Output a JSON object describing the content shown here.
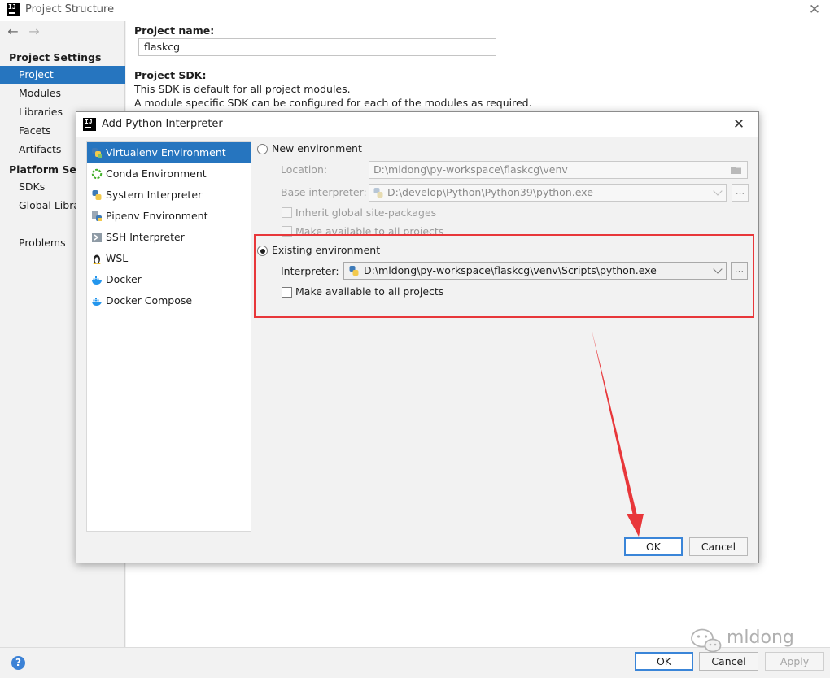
{
  "window": {
    "title": "Project Structure",
    "logo_text": "IJ"
  },
  "sidebar": {
    "project_settings_header": "Project Settings",
    "project_settings_items": [
      {
        "label": "Project",
        "selected": true
      },
      {
        "label": "Modules"
      },
      {
        "label": "Libraries"
      },
      {
        "label": "Facets"
      },
      {
        "label": "Artifacts"
      }
    ],
    "platform_settings_header": "Platform Settings",
    "platform_settings_items": [
      {
        "label": "SDKs"
      },
      {
        "label": "Global Libraries"
      }
    ],
    "problems_label": "Problems"
  },
  "content": {
    "project_name_label": "Project name:",
    "project_name_value": "flaskcg",
    "project_sdk_label": "Project SDK:",
    "sdk_desc_1": "This SDK is default for all project modules.",
    "sdk_desc_2": "A module specific SDK can be configured for each of the modules as required."
  },
  "footer": {
    "help_glyph": "?",
    "ok_label": "OK",
    "cancel_label": "Cancel",
    "apply_label": "Apply"
  },
  "dialog": {
    "title": "Add Python Interpreter",
    "logo_text": "IJ",
    "env_items": [
      {
        "label": "Virtualenv Environment",
        "icon": "virtualenv-icon",
        "selected": true
      },
      {
        "label": "Conda Environment",
        "icon": "conda-icon"
      },
      {
        "label": "System Interpreter",
        "icon": "python-icon"
      },
      {
        "label": "Pipenv Environment",
        "icon": "pipenv-icon"
      },
      {
        "label": "SSH Interpreter",
        "icon": "ssh-icon"
      },
      {
        "label": "WSL",
        "icon": "linux-icon"
      },
      {
        "label": "Docker",
        "icon": "docker-icon"
      },
      {
        "label": "Docker Compose",
        "icon": "docker-compose-icon"
      }
    ],
    "new_env": {
      "label": "New environment",
      "selected": false,
      "location_label": "Location:",
      "location_value": "D:\\mldong\\py-workspace\\flaskcg\\venv",
      "base_interpreter_label": "Base interpreter:",
      "base_interpreter_value": "D:\\develop\\Python\\Python39\\python.exe",
      "inherit_label": "Inherit global site-packages",
      "make_available_label": "Make available to all projects"
    },
    "existing_env": {
      "label": "Existing environment",
      "selected": true,
      "interpreter_label": "Interpreter:",
      "interpreter_value": "D:\\mldong\\py-workspace\\flaskcg\\venv\\Scripts\\python.exe",
      "make_available_label": "Make available to all projects"
    },
    "browse_glyph": "...",
    "ok_label": "OK",
    "cancel_label": "Cancel"
  },
  "watermark": "mldong",
  "colors": {
    "selection": "#2675bf",
    "annotation_red": "#e8373a",
    "default_button_border": "#3a85d8"
  }
}
